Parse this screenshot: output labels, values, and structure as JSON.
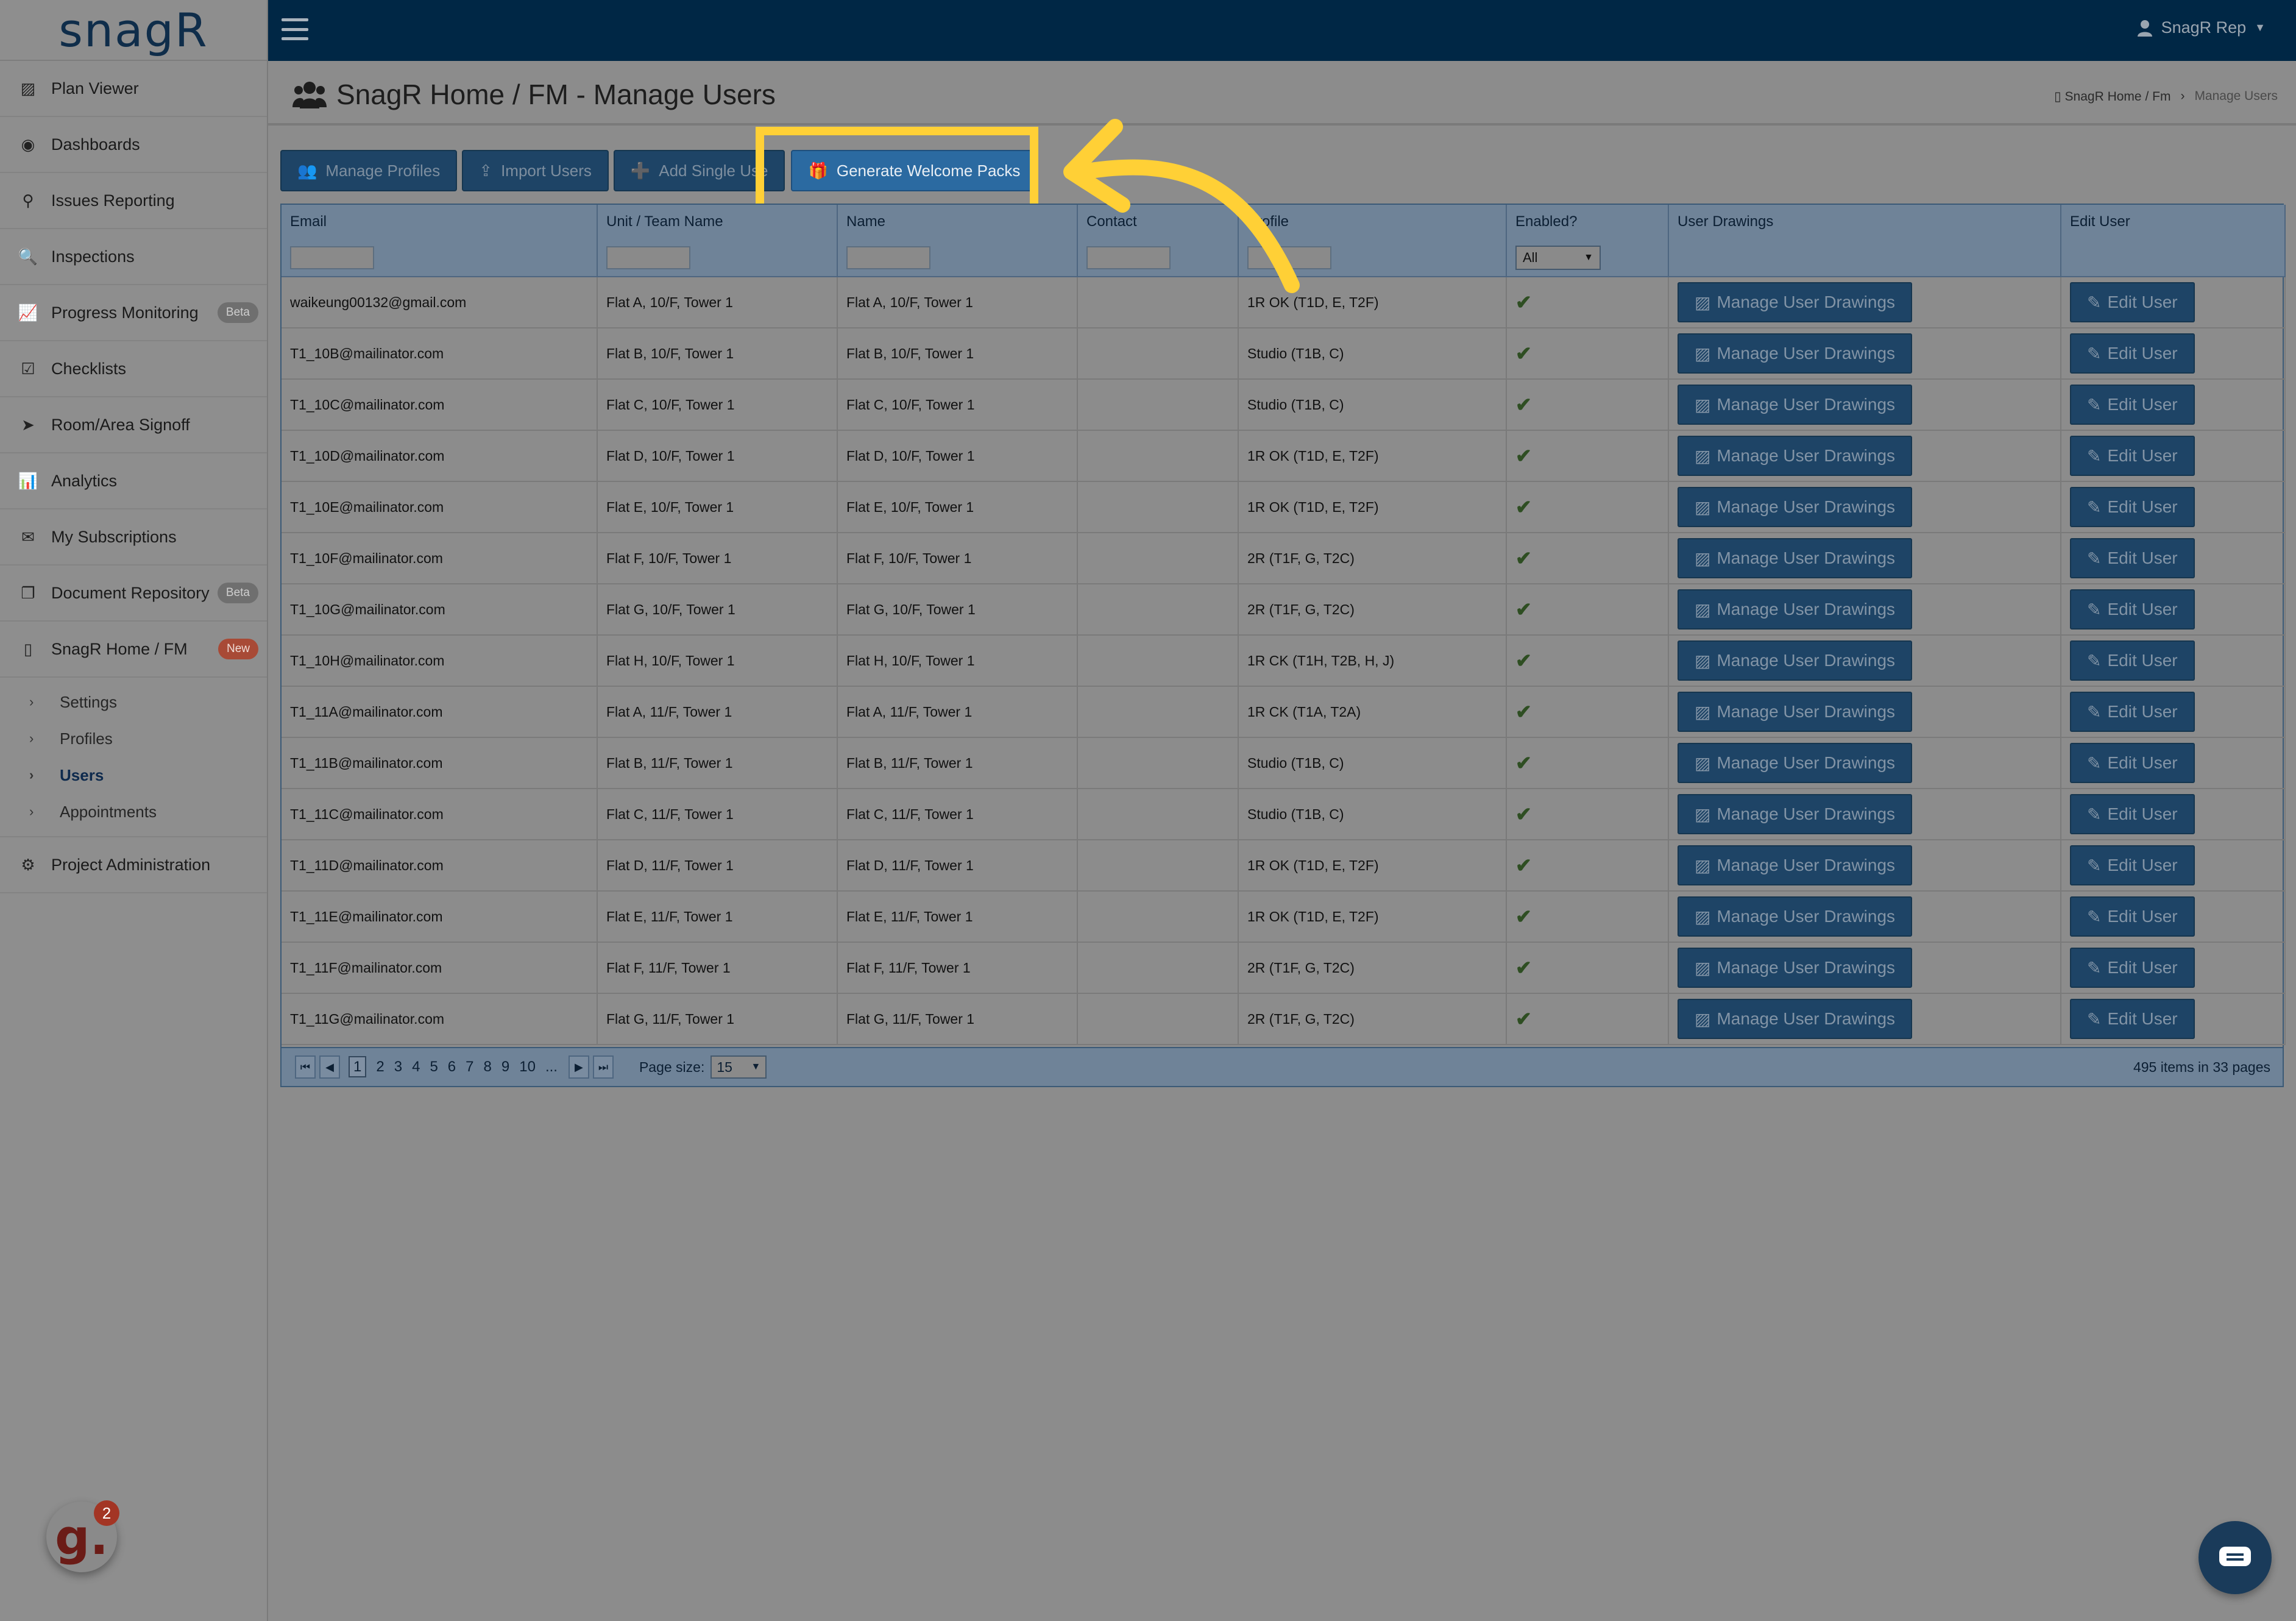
{
  "app": {
    "logo": "snagR"
  },
  "topbar": {
    "user_label": "SnagR Rep"
  },
  "sidebar": {
    "items": [
      {
        "label": "Plan Viewer",
        "icon": "image-icon"
      },
      {
        "label": "Dashboards",
        "icon": "dashboard-icon"
      },
      {
        "label": "Issues Reporting",
        "icon": "map-pin-icon"
      },
      {
        "label": "Inspections",
        "icon": "search-icon"
      },
      {
        "label": "Progress Monitoring",
        "icon": "line-chart-icon",
        "badge": "Beta"
      },
      {
        "label": "Checklists",
        "icon": "checkbox-icon"
      },
      {
        "label": "Room/Area Signoff",
        "icon": "location-arrow-icon"
      },
      {
        "label": "Analytics",
        "icon": "bar-chart-icon"
      },
      {
        "label": "My Subscriptions",
        "icon": "envelope-icon"
      },
      {
        "label": "Document Repository",
        "icon": "documents-icon",
        "badge": "Beta"
      },
      {
        "label": "SnagR Home / FM",
        "icon": "building-icon",
        "badge": "New"
      }
    ],
    "subitems": [
      {
        "label": "Settings"
      },
      {
        "label": "Profiles"
      },
      {
        "label": "Users"
      },
      {
        "label": "Appointments"
      }
    ],
    "admin": {
      "label": "Project Administration",
      "icon": "cogs-icon"
    }
  },
  "page": {
    "title": "SnagR Home / FM - Manage Users",
    "breadcrumb": {
      "parent": "SnagR Home / Fm",
      "current": "Manage Users"
    }
  },
  "toolbar": {
    "manage_profiles": "Manage Profiles",
    "import_users": "Import Users",
    "add_single_user": "Add Single Use",
    "generate_welcome_packs": "Generate Welcome Packs"
  },
  "grid": {
    "columns": [
      "Email",
      "Unit / Team Name",
      "Name",
      "Contact",
      "Profile",
      "Enabled?",
      "User Drawings",
      "Edit User"
    ],
    "enabled_filter": "All",
    "manage_label": "Manage User Drawings",
    "edit_label": "Edit User",
    "rows": [
      {
        "email": "waikeung00132@gmail.com",
        "unit": "Flat A, 10/F, Tower 1",
        "name": "Flat A, 10/F, Tower 1",
        "contact": "",
        "profile": "1R OK (T1D, E, T2F)"
      },
      {
        "email": "T1_10B@mailinator.com",
        "unit": "Flat B, 10/F, Tower 1",
        "name": "Flat B, 10/F, Tower 1",
        "contact": "",
        "profile": "Studio (T1B, C)"
      },
      {
        "email": "T1_10C@mailinator.com",
        "unit": "Flat C, 10/F, Tower 1",
        "name": "Flat C, 10/F, Tower 1",
        "contact": "",
        "profile": "Studio (T1B, C)"
      },
      {
        "email": "T1_10D@mailinator.com",
        "unit": "Flat D, 10/F, Tower 1",
        "name": "Flat D, 10/F, Tower 1",
        "contact": "",
        "profile": "1R OK (T1D, E, T2F)"
      },
      {
        "email": "T1_10E@mailinator.com",
        "unit": "Flat E, 10/F, Tower 1",
        "name": "Flat E, 10/F, Tower 1",
        "contact": "",
        "profile": "1R OK (T1D, E, T2F)"
      },
      {
        "email": "T1_10F@mailinator.com",
        "unit": "Flat F, 10/F, Tower 1",
        "name": "Flat F, 10/F, Tower 1",
        "contact": "",
        "profile": "2R (T1F, G, T2C)"
      },
      {
        "email": "T1_10G@mailinator.com",
        "unit": "Flat G, 10/F, Tower 1",
        "name": "Flat G, 10/F, Tower 1",
        "contact": "",
        "profile": "2R (T1F, G, T2C)"
      },
      {
        "email": "T1_10H@mailinator.com",
        "unit": "Flat H, 10/F, Tower 1",
        "name": "Flat H, 10/F, Tower 1",
        "contact": "",
        "profile": "1R CK (T1H, T2B, H, J)"
      },
      {
        "email": "T1_11A@mailinator.com",
        "unit": "Flat A, 11/F, Tower 1",
        "name": "Flat A, 11/F, Tower 1",
        "contact": "",
        "profile": "1R CK (T1A, T2A)"
      },
      {
        "email": "T1_11B@mailinator.com",
        "unit": "Flat B, 11/F, Tower 1",
        "name": "Flat B, 11/F, Tower 1",
        "contact": "",
        "profile": "Studio (T1B, C)"
      },
      {
        "email": "T1_11C@mailinator.com",
        "unit": "Flat C, 11/F, Tower 1",
        "name": "Flat C, 11/F, Tower 1",
        "contact": "",
        "profile": "Studio (T1B, C)"
      },
      {
        "email": "T1_11D@mailinator.com",
        "unit": "Flat D, 11/F, Tower 1",
        "name": "Flat D, 11/F, Tower 1",
        "contact": "",
        "profile": "1R OK (T1D, E, T2F)"
      },
      {
        "email": "T1_11E@mailinator.com",
        "unit": "Flat E, 11/F, Tower 1",
        "name": "Flat E, 11/F, Tower 1",
        "contact": "",
        "profile": "1R OK (T1D, E, T2F)"
      },
      {
        "email": "T1_11F@mailinator.com",
        "unit": "Flat F, 11/F, Tower 1",
        "name": "Flat F, 11/F, Tower 1",
        "contact": "",
        "profile": "2R (T1F, G, T2C)"
      },
      {
        "email": "T1_11G@mailinator.com",
        "unit": "Flat G, 11/F, Tower 1",
        "name": "Flat G, 11/F, Tower 1",
        "contact": "",
        "profile": "2R (T1F, G, T2C)"
      }
    ]
  },
  "pager": {
    "pages": [
      "1",
      "2",
      "3",
      "4",
      "5",
      "6",
      "7",
      "8",
      "9",
      "10",
      "..."
    ],
    "current": "1",
    "page_size_label": "Page size:",
    "page_size": "15",
    "summary": "495 items in 33 pages"
  },
  "launcher": {
    "letter": "g.",
    "count": "2"
  },
  "colors": {
    "topbar": "#002745",
    "accent": "#2b6aa1",
    "highlight": "#ffd036"
  }
}
